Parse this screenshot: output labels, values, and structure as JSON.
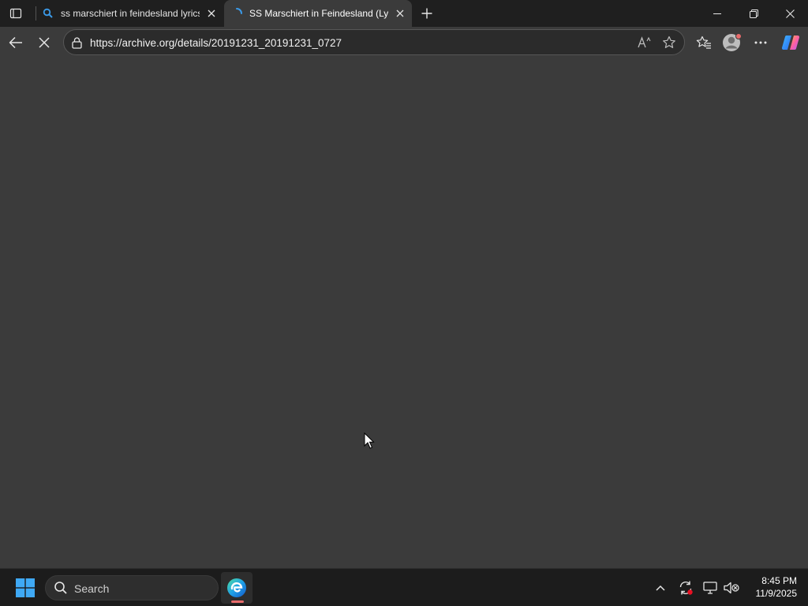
{
  "browser": {
    "tabs": [
      {
        "title": "ss marschiert in feindesland lyrics",
        "active": false,
        "favicon": "search-icon"
      },
      {
        "title": "SS Marschiert in Feindesland (Lyrics)",
        "active": true,
        "favicon": "loading-spinner-icon"
      }
    ],
    "address_bar": {
      "url": "https://archive.org/details/20191231_20191231_0727"
    },
    "page_state": "loading"
  },
  "taskbar": {
    "search_placeholder": "Search",
    "clock": {
      "time": "8:45 PM",
      "date": "11/9/2025"
    }
  },
  "colors": {
    "tabstrip_bg": "#1f1f1f",
    "toolbar_bg": "#3b3b3b",
    "content_bg": "#3b3b3b",
    "taskbar_bg": "#1c1c1c",
    "accent_blue": "#3b9ae8"
  }
}
